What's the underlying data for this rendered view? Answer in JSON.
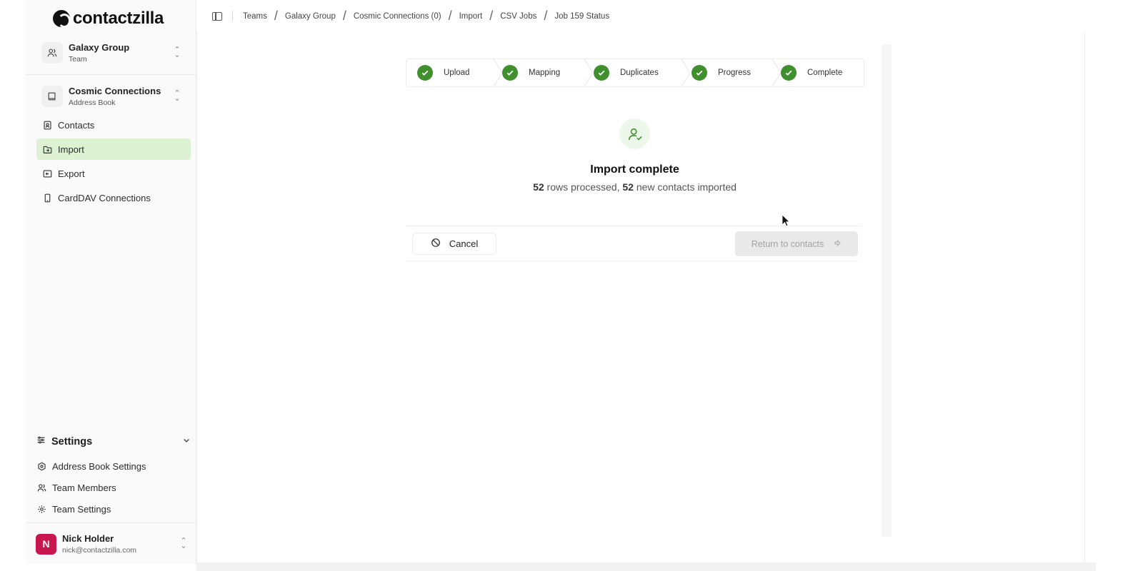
{
  "app": {
    "logo_text": "contactzilla"
  },
  "team_switcher": {
    "name": "Galaxy Group",
    "kind": "Team"
  },
  "book_switcher": {
    "name": "Cosmic Connections",
    "kind": "Address Book"
  },
  "nav": {
    "items": [
      {
        "label": "Contacts",
        "icon": "contact-card-icon",
        "active": false
      },
      {
        "label": "Import",
        "icon": "folder-import-icon",
        "active": true
      },
      {
        "label": "Export",
        "icon": "export-icon",
        "active": false
      },
      {
        "label": "CardDAV Connections",
        "icon": "phone-icon",
        "active": false
      }
    ]
  },
  "settings": {
    "title": "Settings",
    "items": [
      {
        "label": "Address Book Settings",
        "icon": "hex-settings-icon"
      },
      {
        "label": "Team Members",
        "icon": "users-icon"
      },
      {
        "label": "Team Settings",
        "icon": "gear-icon"
      }
    ]
  },
  "user": {
    "initial": "N",
    "name": "Nick Holder",
    "email": "nick@contactzilla.com"
  },
  "breadcrumb": [
    "Teams",
    "Galaxy Group",
    "Cosmic Connections (0)",
    "Import",
    "CSV Jobs",
    "Job 159 Status"
  ],
  "stepper": {
    "steps": [
      {
        "label": "Upload",
        "done": true
      },
      {
        "label": "Mapping",
        "done": true
      },
      {
        "label": "Duplicates",
        "done": true
      },
      {
        "label": "Progress",
        "done": true
      },
      {
        "label": "Complete",
        "done": true
      }
    ]
  },
  "result": {
    "title": "Import complete",
    "rows_processed": "52",
    "rows_text": "rows processed,",
    "new_contacts": "52",
    "new_text": "new contacts imported"
  },
  "actions": {
    "cancel_label": "Cancel",
    "return_label": "Return to contacts"
  },
  "colors": {
    "accent_green": "#3f8f2e",
    "active_nav_bg": "#dcf2d3",
    "avatar_bg": "#c8174e"
  }
}
